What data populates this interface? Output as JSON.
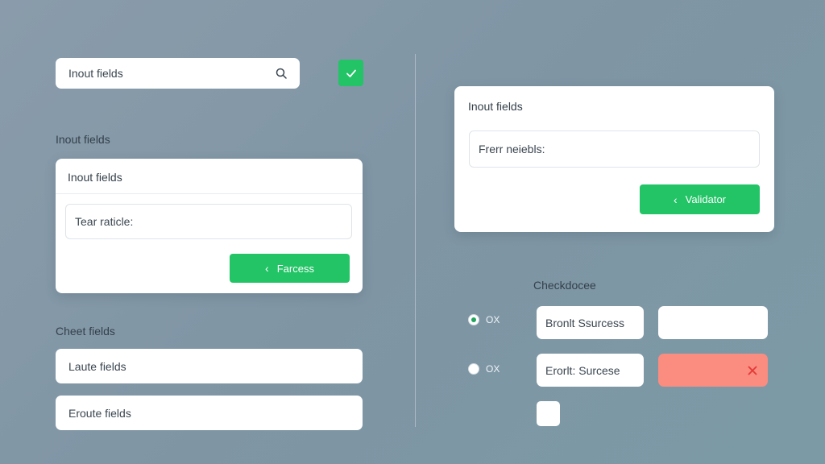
{
  "left": {
    "search": {
      "value": "Inout fields"
    },
    "section1_label": "Inout fields",
    "card": {
      "header": "Inout fields",
      "input_value": "Tear raticle:",
      "button_label": "Farcess"
    },
    "section2_label": "Cheet fields",
    "field1": "Laute fields",
    "field2": "Eroute fields"
  },
  "right": {
    "card": {
      "header": "Inout fields",
      "input_value": "Frerr neiebls:",
      "button_label": "Validator"
    },
    "checkbox_label": "Checkdocee",
    "rows": [
      {
        "radio_label": "OX",
        "checked": true,
        "status_label": "Bronlt Ssurcess"
      },
      {
        "radio_label": "OX",
        "checked": false,
        "status_label": "Erorlt: Surcese"
      }
    ]
  },
  "colors": {
    "accent": "#22c466",
    "error": "#fa8c80",
    "error_icon": "#e53935"
  },
  "icons": [
    "search-icon",
    "check-icon",
    "chevron-left-icon",
    "close-icon"
  ]
}
